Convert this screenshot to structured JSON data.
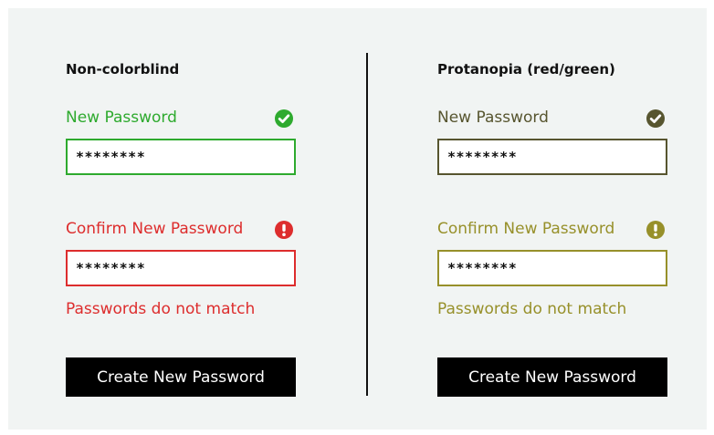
{
  "panels": [
    {
      "heading": "Non-colorblind",
      "new_password": {
        "label": "New Password",
        "value": "********",
        "status_icon": "check-circle-icon",
        "color": "#2eaa2e"
      },
      "confirm_password": {
        "label": "Confirm New Password",
        "value": "********",
        "status_icon": "exclamation-circle-icon",
        "color": "#dd2d2d"
      },
      "error_message": "Passwords do not match",
      "submit_label": "Create New Password"
    },
    {
      "heading": "Protanopia (red/green)",
      "new_password": {
        "label": "New Password",
        "value": "********",
        "status_icon": "check-circle-icon",
        "color": "#57552f"
      },
      "confirm_password": {
        "label": "Confirm New Password",
        "value": "********",
        "status_icon": "exclamation-circle-icon",
        "color": "#97902a"
      },
      "error_message": "Passwords do not match",
      "submit_label": "Create New Password"
    }
  ],
  "colors": {
    "canvas_background": "#f1f4f3",
    "divider": "#111111",
    "button_background": "#000000",
    "button_text": "#ffffff"
  }
}
